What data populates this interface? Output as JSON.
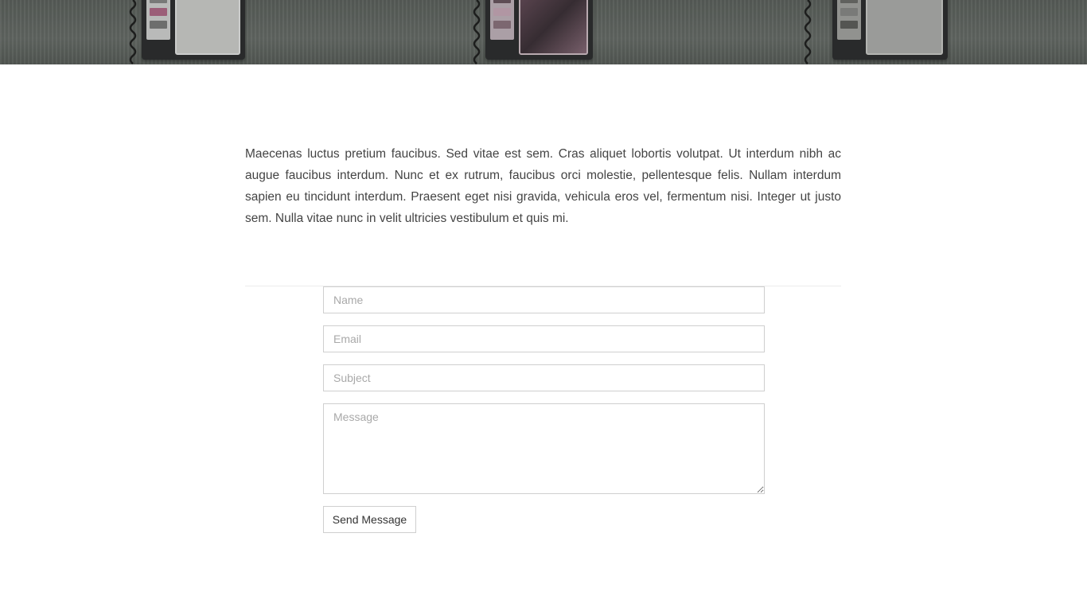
{
  "hero": {
    "image": "wall-mounted-payphones-photo"
  },
  "intro": {
    "text": "Maecenas luctus pretium faucibus. Sed vitae est sem. Cras aliquet lobortis volutpat. Ut interdum nibh ac augue faucibus interdum. Nunc et ex rutrum, faucibus orci molestie, pellentesque felis. Nullam interdum sapien eu tincidunt interdum. Praesent eget nisi gravida, vehicula eros vel, fermentum nisi. Integer ut justo sem. Nulla vitae nunc in velit ultricies vestibulum et quis mi."
  },
  "contact_form": {
    "name": {
      "placeholder": "Name",
      "value": ""
    },
    "email": {
      "placeholder": "Email",
      "value": ""
    },
    "subject": {
      "placeholder": "Subject",
      "value": ""
    },
    "message": {
      "placeholder": "Message",
      "value": ""
    },
    "submit_label": "Send Message"
  },
  "colors": {
    "text": "#444444",
    "border": "#cfcfcf",
    "placeholder": "#a9a9a9",
    "background": "#ffffff"
  }
}
